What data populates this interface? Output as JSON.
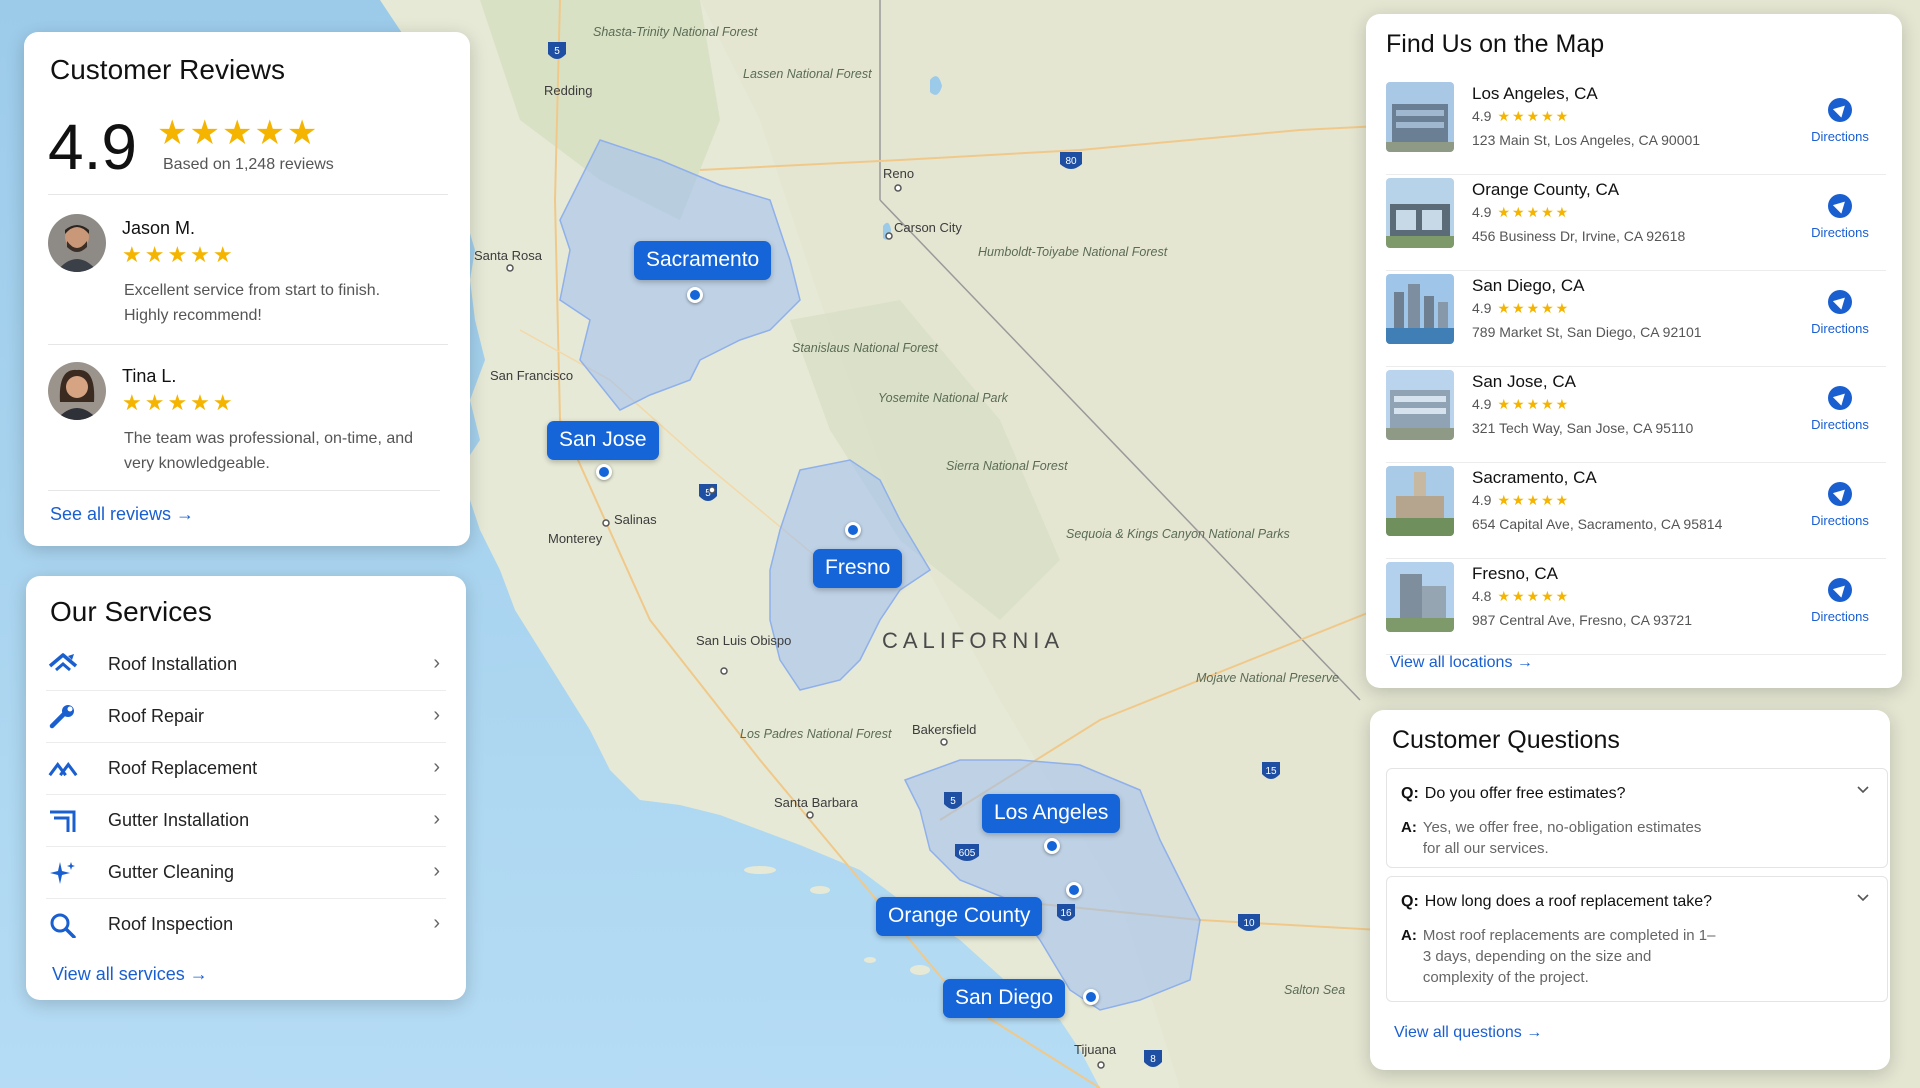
{
  "map": {
    "state_label": "CALIFORNIA",
    "places": [
      "Shasta-Trinity National Forest",
      "Redding",
      "Lassen National Forest",
      "Reno",
      "Carson City",
      "Humboldt-Toiyabe National Forest",
      "Santa Rosa",
      "San Francisco",
      "Stanislaus National Forest",
      "Yosemite National Park",
      "Sierra National Forest",
      "Salinas",
      "Monterey",
      "Sequoia & Kings Canyon National Parks",
      "San Luis Obispo",
      "Mojave National Preserve",
      "Bakersfield",
      "Los Padres National Forest",
      "Santa Barbara",
      "Salton Sea",
      "Tijuana"
    ],
    "highways": [
      "5",
      "80",
      "5",
      "5",
      "15",
      "605",
      "16",
      "10",
      "8"
    ],
    "service_areas": [
      "Sacramento",
      "San Jose",
      "Fresno",
      "Los Angeles",
      "Orange County",
      "San Diego"
    ]
  },
  "reviews": {
    "title": "Customer Reviews",
    "rating": "4.9",
    "stars": "★★★★★",
    "count_text": "Based on 1,248 reviews",
    "items": [
      {
        "name": "Jason M.",
        "stars": "★★★★★",
        "text": "Excellent service from start to finish. Highly recommend!"
      },
      {
        "name": "Tina L.",
        "stars": "★★★★★",
        "text": "The team was professional, on-time, and very knowledgeable."
      }
    ],
    "link": "See all reviews →"
  },
  "services": {
    "title": "Our Services",
    "items": [
      {
        "label": "Roof Installation",
        "icon": "roof-installation-icon"
      },
      {
        "label": "Roof Repair",
        "icon": "wrench-icon"
      },
      {
        "label": "Roof Replacement",
        "icon": "roof-replacement-icon"
      },
      {
        "label": "Gutter Installation",
        "icon": "gutter-icon"
      },
      {
        "label": "Gutter Cleaning",
        "icon": "sparkle-icon"
      },
      {
        "label": "Roof Inspection",
        "icon": "search-icon"
      }
    ],
    "link": "View all services →"
  },
  "locations": {
    "title": "Find Us on the Map",
    "directions_label": "Directions",
    "items": [
      {
        "city": "Los Angeles, CA",
        "rating": "4.9",
        "stars": "★★★★★",
        "address": "123 Main St, Los Angeles, CA 90001"
      },
      {
        "city": "Orange County, CA",
        "rating": "4.9",
        "stars": "★★★★★",
        "address": "456 Business Dr, Irvine, CA 92618"
      },
      {
        "city": "San Diego, CA",
        "rating": "4.9",
        "stars": "★★★★★",
        "address": "789 Market St, San Diego, CA 92101"
      },
      {
        "city": "San Jose, CA",
        "rating": "4.9",
        "stars": "★★★★★",
        "address": "321 Tech Way, San Jose, CA 95110"
      },
      {
        "city": "Sacramento, CA",
        "rating": "4.9",
        "stars": "★★★★★",
        "address": "654 Capital Ave, Sacramento, CA 95814"
      },
      {
        "city": "Fresno, CA",
        "rating": "4.8",
        "stars": "★★★★★",
        "address": "987 Central Ave, Fresno, CA 93721"
      }
    ],
    "link": "View all locations →"
  },
  "faq": {
    "title": "Customer Questions",
    "q_prefix": "Q:",
    "a_prefix": "A:",
    "items": [
      {
        "q": "Do you offer free estimates?",
        "a": "Yes, we offer free, no-obligation estimates for all our services."
      },
      {
        "q": "How long does a roof replacement take?",
        "a": "Most roof replacements are completed in 1–3 days, depending on the size and complexity of the project."
      }
    ],
    "link": "View all questions →"
  },
  "colors": {
    "accent": "#1565d8",
    "link": "#1a5fd0",
    "star": "#f5b400",
    "ocean": "#a9d3ef",
    "land": "#e9ecde"
  }
}
